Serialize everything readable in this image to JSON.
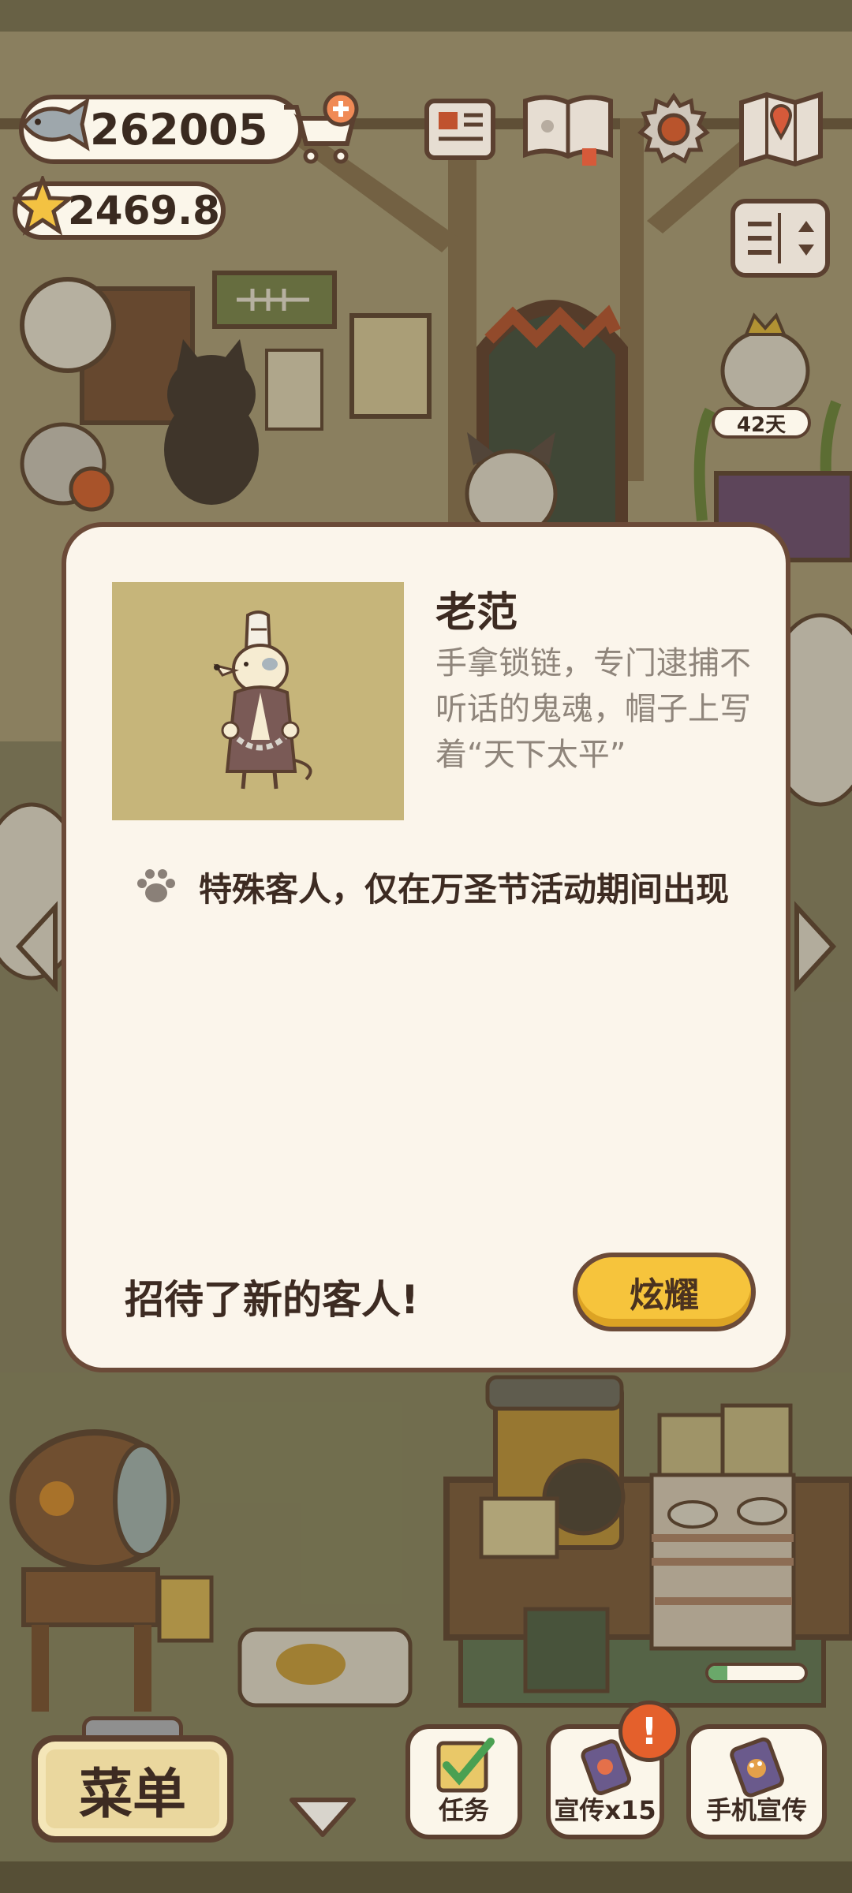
{
  "currency": {
    "fish": "262005",
    "stars": "2469.8"
  },
  "icons": {
    "fish": "fish-icon",
    "cart": "cart-add-icon",
    "star": "star-icon",
    "newspaper": "newspaper-icon",
    "book": "guest-book-icon",
    "settings": "gear-icon",
    "map": "map-icon",
    "layout": "layout-toggle-icon",
    "paw": "paw-icon",
    "tasks": "checklist-icon",
    "promo": "phone-promo-icon",
    "alert": "alert-icon",
    "down": "chevron-down-icon"
  },
  "scene": {
    "event_days": "42天"
  },
  "modal": {
    "guest_name": "老范",
    "description": "手拿锁链，专门逮捕不听话的鬼魂，帽子上写着“天下太平”",
    "special_note": "特殊客人，仅在万圣节活动期间出现",
    "footer_text": "招待了新的客人!",
    "show_off_button": "炫耀"
  },
  "bottom_bar": {
    "menu": "菜单",
    "tasks": "任务",
    "promo": "宣传x15",
    "phone_promo": "手机宣传",
    "alert_mark": "!",
    "progress": 0.2
  },
  "colors": {
    "accent": "#f6c43c",
    "outline": "#5b4030",
    "panel": "#fbf5eb",
    "alert": "#e4602c"
  }
}
